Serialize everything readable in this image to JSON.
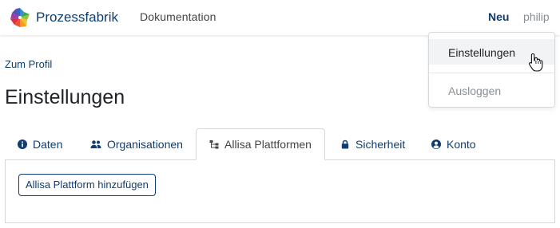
{
  "navbar": {
    "brand_name": "Prozessfabrik",
    "docs_link": "Dokumentation",
    "new_link": "Neu",
    "user_name": "philip"
  },
  "user_menu": {
    "items": [
      {
        "label": "Einstellungen",
        "hovered": true
      },
      {
        "label": "Ausloggen",
        "hovered": false
      }
    ]
  },
  "page": {
    "back_link": "Zum Profil",
    "title": "Einstellungen"
  },
  "tabs": [
    {
      "label": "Daten",
      "icon": "info-icon",
      "active": false
    },
    {
      "label": "Organisationen",
      "icon": "users-icon",
      "active": false
    },
    {
      "label": "Allisa Plattformen",
      "icon": "sitemap-icon",
      "active": true
    },
    {
      "label": "Sicherheit",
      "icon": "lock-icon",
      "active": false
    },
    {
      "label": "Konto",
      "icon": "user-circle-icon",
      "active": false
    }
  ],
  "panel": {
    "add_button_label": "Allisa Plattform hinzufügen"
  },
  "colors": {
    "primary": "#0f3d6e",
    "muted": "#8a8f95",
    "border": "#d5d9de"
  }
}
